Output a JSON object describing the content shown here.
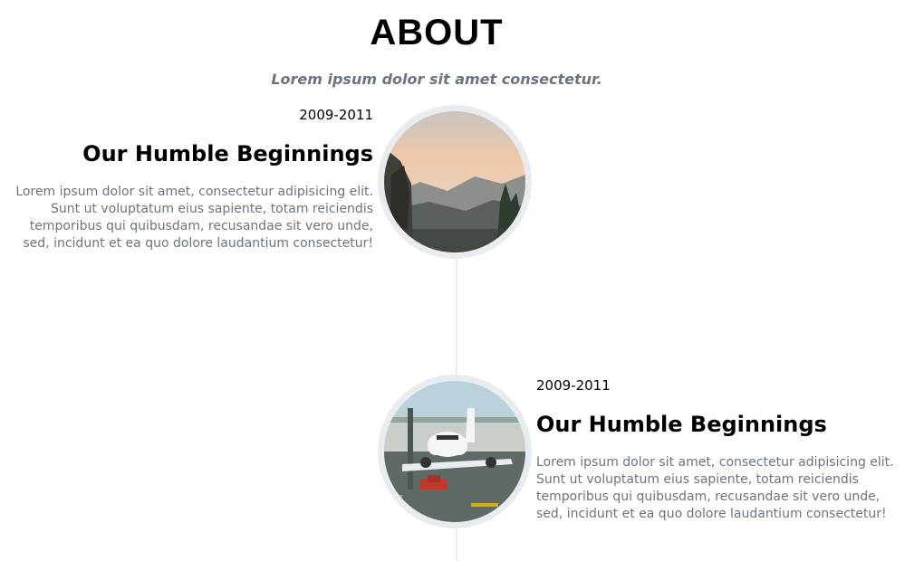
{
  "about": {
    "title": "ABOUT",
    "subtitle": "Lorem ipsum dolor sit amet consectetur."
  },
  "timeline": {
    "items": [
      {
        "date": "2009-2011",
        "heading": "Our Humble Beginnings",
        "body": "Lorem ipsum dolor sit amet, consectetur adipisicing elit. Sunt ut voluptatum eius sapiente, totam reiciendis temporibus qui quibusdam, recusandae sit vero unde, sed, incidunt et ea quo dolore laudantium consectetur!",
        "image": "mountain-valley-photo"
      },
      {
        "date": "2009-2011",
        "heading": "Our Humble Beginnings",
        "body": "Lorem ipsum dolor sit amet, consectetur adipisicing elit. Sunt ut voluptatum eius sapiente, totam reiciendis temporibus qui quibusdam, recusandae sit vero unde, sed, incidunt et ea quo dolore laudantium consectetur!",
        "image": "airplane-on-tarmac-photo"
      }
    ]
  }
}
